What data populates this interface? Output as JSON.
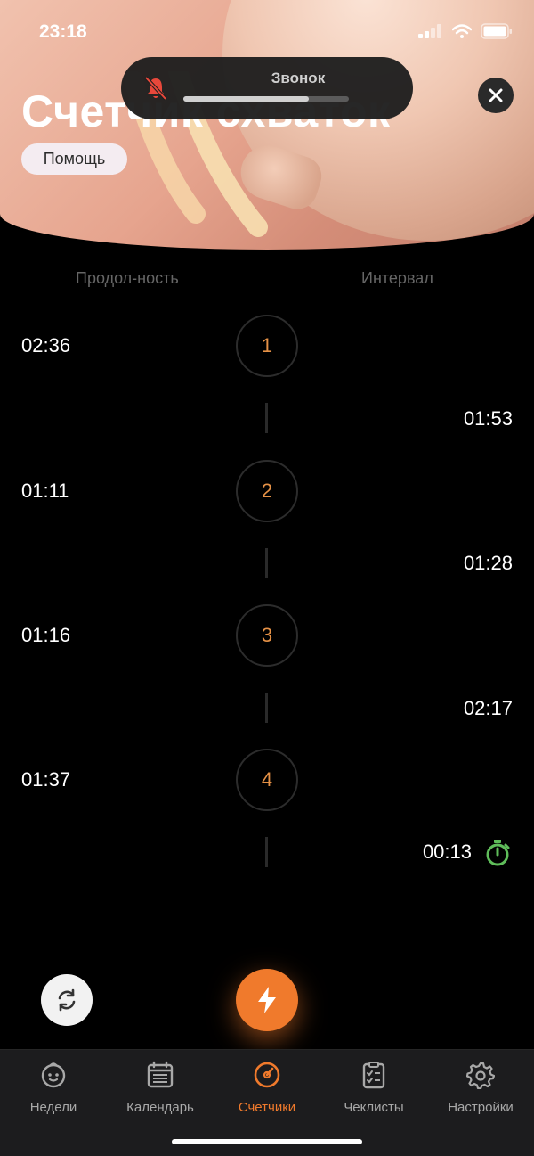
{
  "status_bar": {
    "time": "23:18"
  },
  "ringer_hud": {
    "label": "Звонок",
    "volume_fraction": 0.76
  },
  "header": {
    "title": "Счетчик схваток",
    "help_label": "Помощь"
  },
  "columns": {
    "duration_label": "Продол-ность",
    "interval_label": "Интервал"
  },
  "contractions": [
    {
      "number": "1",
      "duration": "02:36",
      "interval_after": "01:53"
    },
    {
      "number": "2",
      "duration": "01:11",
      "interval_after": "01:28"
    },
    {
      "number": "3",
      "duration": "01:16",
      "interval_after": "02:17"
    },
    {
      "number": "4",
      "duration": "01:37",
      "interval_after": "00:13"
    }
  ],
  "tabs": [
    {
      "label": "Недели",
      "icon": "baby-face-icon"
    },
    {
      "label": "Календарь",
      "icon": "calendar-icon"
    },
    {
      "label": "Счетчики",
      "icon": "gauge-icon",
      "active": true
    },
    {
      "label": "Чеклисты",
      "icon": "checklist-icon"
    },
    {
      "label": "Настройки",
      "icon": "gear-icon"
    }
  ],
  "colors": {
    "accent": "#f07a2c",
    "number": "#e59146",
    "timer_green": "#5fbd5a"
  }
}
